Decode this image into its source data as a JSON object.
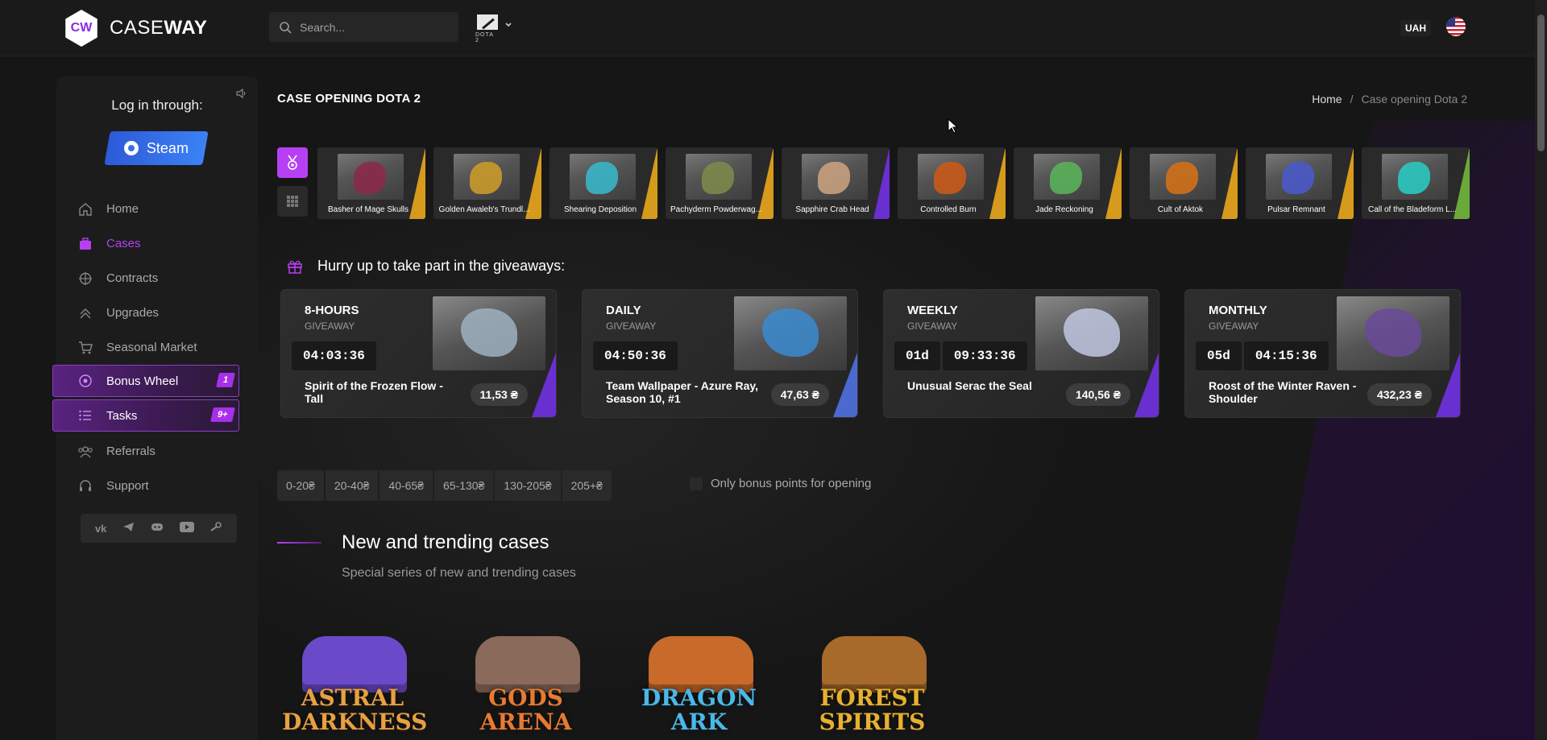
{
  "header": {
    "logo_mark": "CW",
    "logo_text_light": "CASE",
    "logo_text_bold": "WAY",
    "search_placeholder": "Search...",
    "game_label": "DOTA 2",
    "currency": "UAH"
  },
  "sidebar": {
    "login_title": "Log in through:",
    "steam_label": "Steam",
    "nav": [
      {
        "label": "Home",
        "icon": "home-icon"
      },
      {
        "label": "Cases",
        "icon": "cases-icon"
      },
      {
        "label": "Contracts",
        "icon": "contracts-icon"
      },
      {
        "label": "Upgrades",
        "icon": "upgrades-icon"
      },
      {
        "label": "Seasonal Market",
        "icon": "cart-icon"
      },
      {
        "label": "Bonus Wheel",
        "icon": "wheel-icon",
        "badge": "1"
      },
      {
        "label": "Tasks",
        "icon": "tasks-icon",
        "badge": "9+"
      },
      {
        "label": "Referrals",
        "icon": "referrals-icon"
      },
      {
        "label": "Support",
        "icon": "support-icon"
      }
    ],
    "socials": [
      "vk-icon",
      "telegram-icon",
      "discord-icon",
      "youtube-icon",
      "steam-icon"
    ]
  },
  "main": {
    "page_title": "CASE OPENING DOTA 2",
    "breadcrumb": {
      "home": "Home",
      "separator": "/",
      "current": "Case opening Dota 2"
    },
    "live_drops": [
      {
        "name": "Basher of Mage Skulls",
        "rarity_color": "#d69a1c",
        "tint": "#8b2a4a"
      },
      {
        "name": "Golden Awaleb's Trundl...",
        "rarity_color": "#d69a1c",
        "tint": "#c89a2a"
      },
      {
        "name": "Shearing Deposition",
        "rarity_color": "#d69a1c",
        "tint": "#3ab5c8"
      },
      {
        "name": "Pachyderm Powderwag...",
        "rarity_color": "#d69a1c",
        "tint": "#7a8a4a"
      },
      {
        "name": "Sapphire Crab Head",
        "rarity_color": "#6a2fd0",
        "tint": "#c8a080"
      },
      {
        "name": "Controlled Burn",
        "rarity_color": "#d69a1c",
        "tint": "#c85a1a"
      },
      {
        "name": "Jade Reckoning",
        "rarity_color": "#d69a1c",
        "tint": "#5ab05a"
      },
      {
        "name": "Cult of Aktok",
        "rarity_color": "#d69a1c",
        "tint": "#d0701a"
      },
      {
        "name": "Pulsar Remnant",
        "rarity_color": "#d69a1c",
        "tint": "#4a5ac8"
      },
      {
        "name": "Call of the Bladeform L...",
        "rarity_color": "#6aa83a",
        "tint": "#2ac8c0"
      }
    ],
    "giveaway_heading": "Hurry up to take part in the giveaways:",
    "giveaways": [
      {
        "title": "8-HOURS",
        "sub": "GIVEAWAY",
        "timer": [
          "04:03:36"
        ],
        "item": "Spirit of the Frozen Flow - Tall",
        "price": "11,53 ₴",
        "stripe": "#6a2fd0",
        "tint": "#9fb0c0"
      },
      {
        "title": "DAILY",
        "sub": "GIVEAWAY",
        "timer": [
          "04:50:36"
        ],
        "item": "Team Wallpaper - Azure Ray, Season 10, #1",
        "price": "47,63 ₴",
        "stripe": "#4a6ad0",
        "tint": "#3a8ad0"
      },
      {
        "title": "WEEKLY",
        "sub": "GIVEAWAY",
        "timer": [
          "01d",
          "09:33:36"
        ],
        "item": "Unusual Serac the Seal",
        "price": "140,56 ₴",
        "stripe": "#6a2fd0",
        "tint": "#c0c8e0"
      },
      {
        "title": "MONTHLY",
        "sub": "GIVEAWAY",
        "timer": [
          "05d",
          "04:15:36"
        ],
        "item": "Roost of the Winter Raven - Shoulder",
        "price": "432,23 ₴",
        "stripe": "#6a2fd0",
        "tint": "#6a4a9a"
      }
    ],
    "price_filters": [
      "0-20₴",
      "20-40₴",
      "40-65₴",
      "65-130₴",
      "130-205₴",
      "205+₴"
    ],
    "bonus_option": "Only bonus points for opening",
    "section_title": "New and trending cases",
    "section_sub": "Special series of new and trending cases",
    "cases": [
      {
        "label": "ASTRAL\nDARKNESS",
        "color": "#6a4ac8",
        "text": "#e8a040"
      },
      {
        "label": "GODS\nARENA",
        "color": "#8a6a5a",
        "text": "#e87a30"
      },
      {
        "label": "DRAGON\nARK",
        "color": "#c86a2a",
        "text": "#4ab8e8"
      },
      {
        "label": "FOREST\nSPIRITS",
        "color": "#a86a2a",
        "text": "#e8b030"
      }
    ]
  }
}
